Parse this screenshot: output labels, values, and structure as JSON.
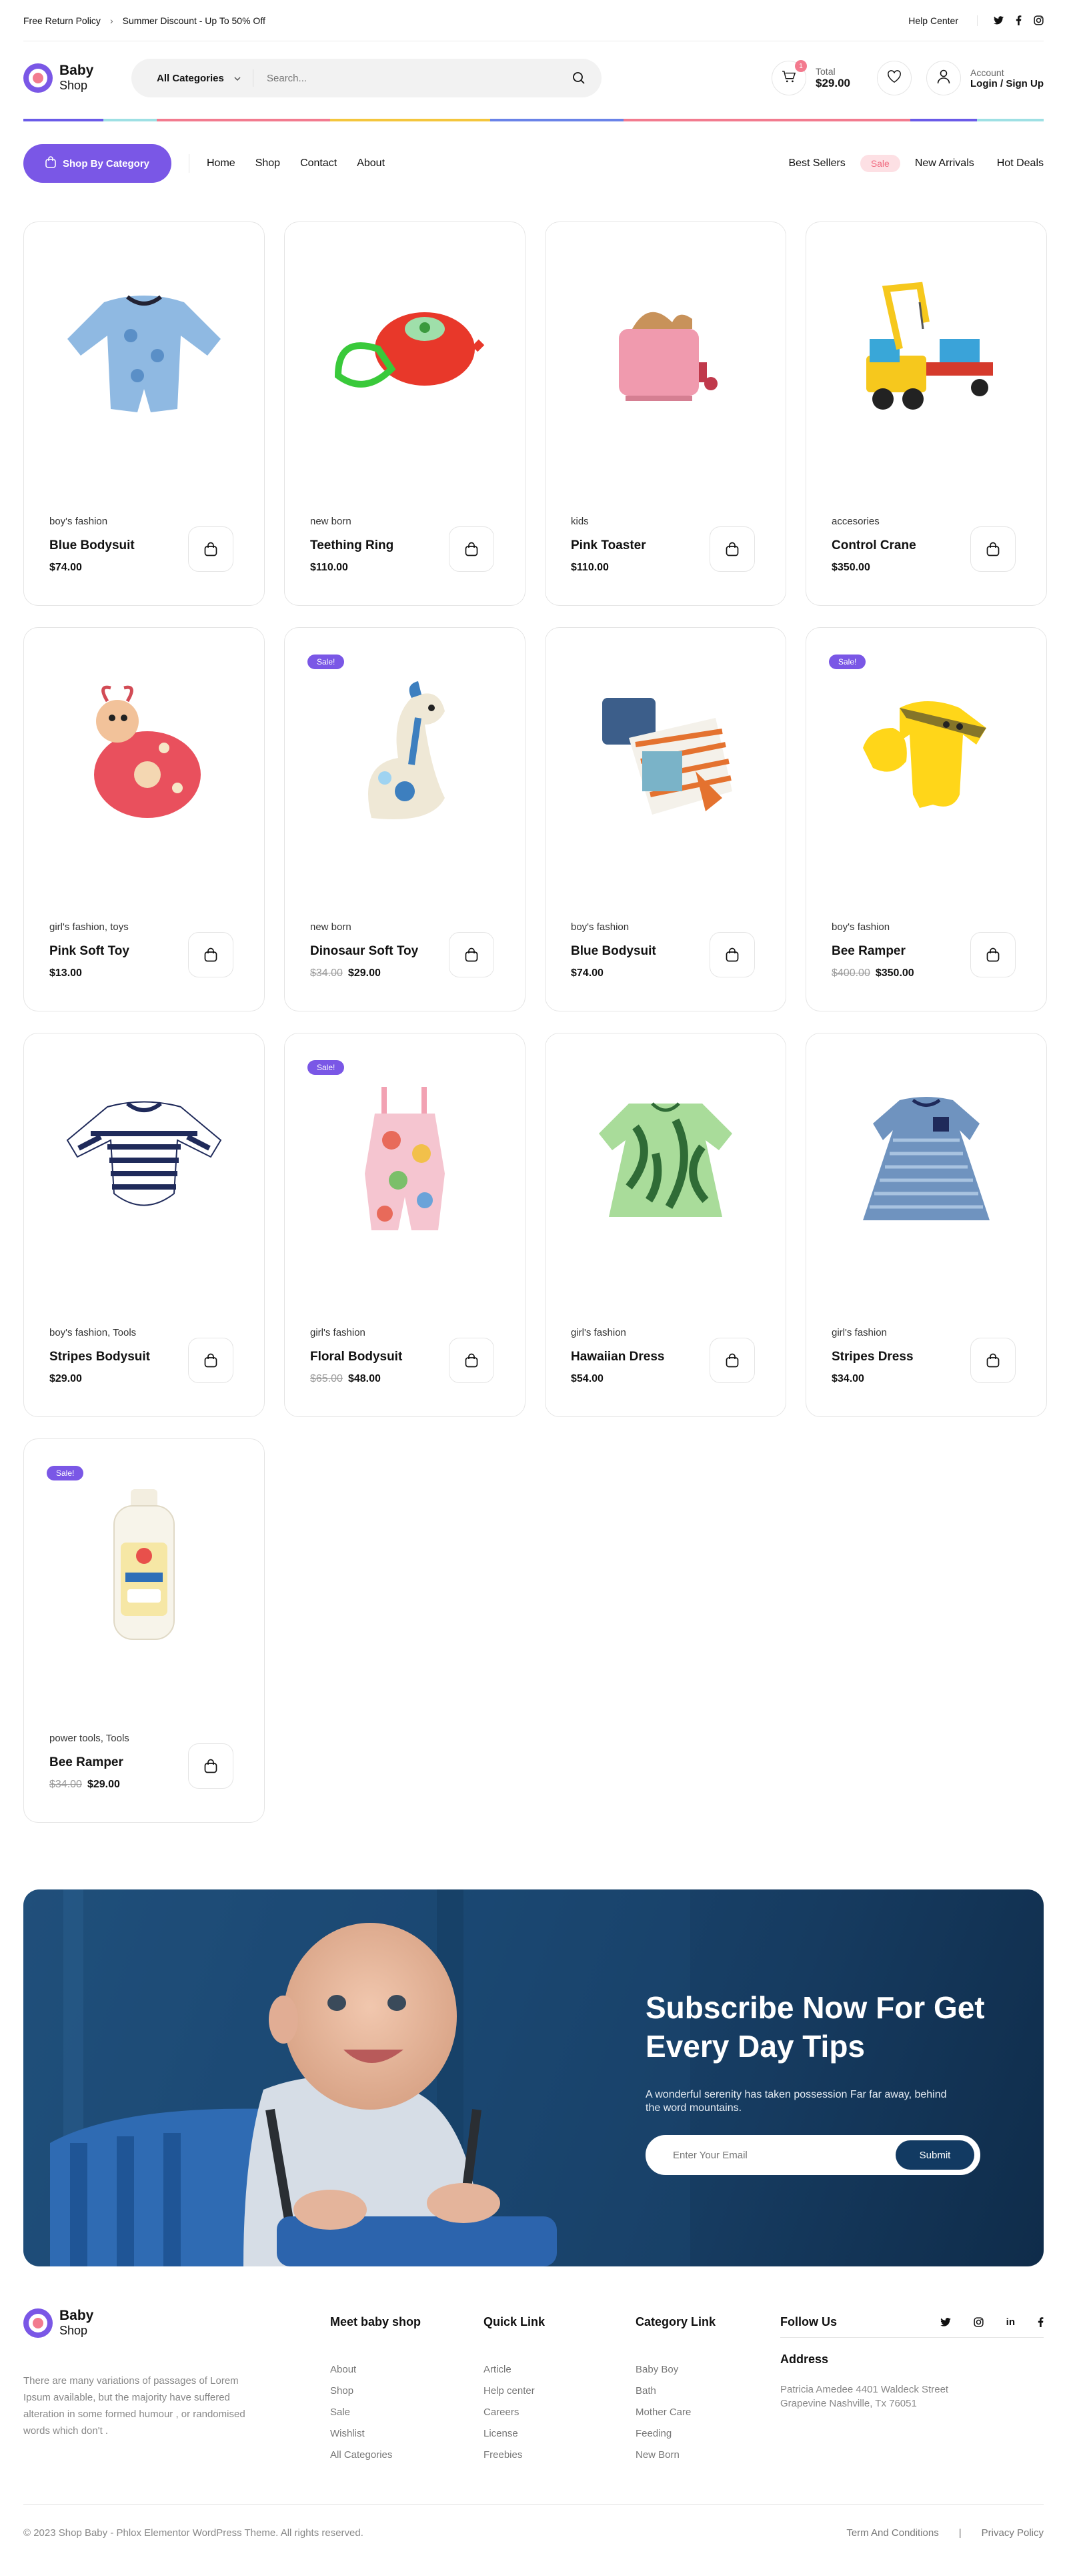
{
  "topbar": {
    "return_policy": "Free Return Policy",
    "discount": "Summer Discount - Up To 50% Off",
    "help": "Help Center"
  },
  "brand": {
    "line1": "Baby",
    "line2": "Shop"
  },
  "search": {
    "category": "All Categories",
    "placeholder": "Search..."
  },
  "cart": {
    "count": "1",
    "label": "Total",
    "total": "$29.00"
  },
  "account": {
    "label": "Account",
    "action": "Login / Sign Up"
  },
  "nav": {
    "shop_by_category": "Shop By Category",
    "menu": [
      "Home",
      "Shop",
      "Contact",
      "About"
    ],
    "right": {
      "best": "Best Sellers",
      "sale": "Sale",
      "new": "New Arrivals",
      "hot": "Hot Deals"
    }
  },
  "products": [
    {
      "category": "boy's fashion",
      "name": "Blue Bodysuit",
      "price": "$74.00",
      "sale": false,
      "old": ""
    },
    {
      "category": "new born",
      "name": "Teething Ring",
      "price": "$110.00",
      "sale": false,
      "old": ""
    },
    {
      "category": "kids",
      "name": "Pink Toaster",
      "price": "$110.00",
      "sale": false,
      "old": ""
    },
    {
      "category": "accesories",
      "name": "Control Crane",
      "price": "$350.00",
      "sale": false,
      "old": ""
    },
    {
      "category": "girl's fashion, toys",
      "name": "Pink Soft Toy",
      "price": "$13.00",
      "sale": false,
      "old": ""
    },
    {
      "category": "new born",
      "name": "Dinosaur Soft Toy",
      "price": "$29.00",
      "sale": true,
      "old": "$34.00"
    },
    {
      "category": "boy's fashion",
      "name": "Blue Bodysuit",
      "price": "$74.00",
      "sale": false,
      "old": ""
    },
    {
      "category": "boy's fashion",
      "name": "Bee Ramper",
      "price": "$350.00",
      "sale": true,
      "old": "$400.00"
    },
    {
      "category": "boy's fashion, Tools",
      "name": "Stripes Bodysuit",
      "price": "$29.00",
      "sale": false,
      "old": ""
    },
    {
      "category": "girl's fashion",
      "name": "Floral Bodysuit",
      "price": "$48.00",
      "sale": true,
      "old": "$65.00"
    },
    {
      "category": "girl's fashion",
      "name": "Hawaiian Dress",
      "price": "$54.00",
      "sale": false,
      "old": ""
    },
    {
      "category": "girl's fashion",
      "name": "Stripes Dress",
      "price": "$34.00",
      "sale": false,
      "old": ""
    },
    {
      "category": "power tools, Tools",
      "name": "Bee Ramper",
      "price": "$29.00",
      "sale": true,
      "old": "$34.00"
    }
  ],
  "sale_badge": "Sale!",
  "subscribe": {
    "title": "Subscribe Now For Get Every Day Tips",
    "desc": "A wonderful serenity has taken possession Far far away, behind the word mountains.",
    "placeholder": "Enter Your Email",
    "button": "Submit"
  },
  "footer": {
    "desc": "There are many variations of passages of Lorem Ipsum available, but the majority have suffered alteration in some formed humour , or randomised words which don't .",
    "meet": {
      "title": "Meet baby shop",
      "links": [
        "About",
        "Shop",
        "Sale",
        "Wishlist",
        "All Categories"
      ]
    },
    "quick": {
      "title": "Quick Link",
      "links": [
        "Article",
        "Help center",
        "Careers",
        "License",
        "Freebies"
      ]
    },
    "category": {
      "title": "Category Link",
      "links": [
        "Baby Boy",
        "Bath",
        "Mother Care",
        "Feeding",
        "New Born"
      ]
    },
    "follow": {
      "title": "Follow Us"
    },
    "address": {
      "title": "Address",
      "line1": "Patricia Amedee 4401 Waldeck Street",
      "line2": "Grapevine Nashville, Tx 76051"
    },
    "copyright": "© 2023 Shop Baby - Phlox Elementor WordPress Theme. All rights reserved.",
    "terms": "Term And Conditions",
    "privacy": "Privacy Policy"
  },
  "colors": {
    "accent": "#7a57e6",
    "pink": "#f27b8f",
    "navy": "#123a62"
  }
}
